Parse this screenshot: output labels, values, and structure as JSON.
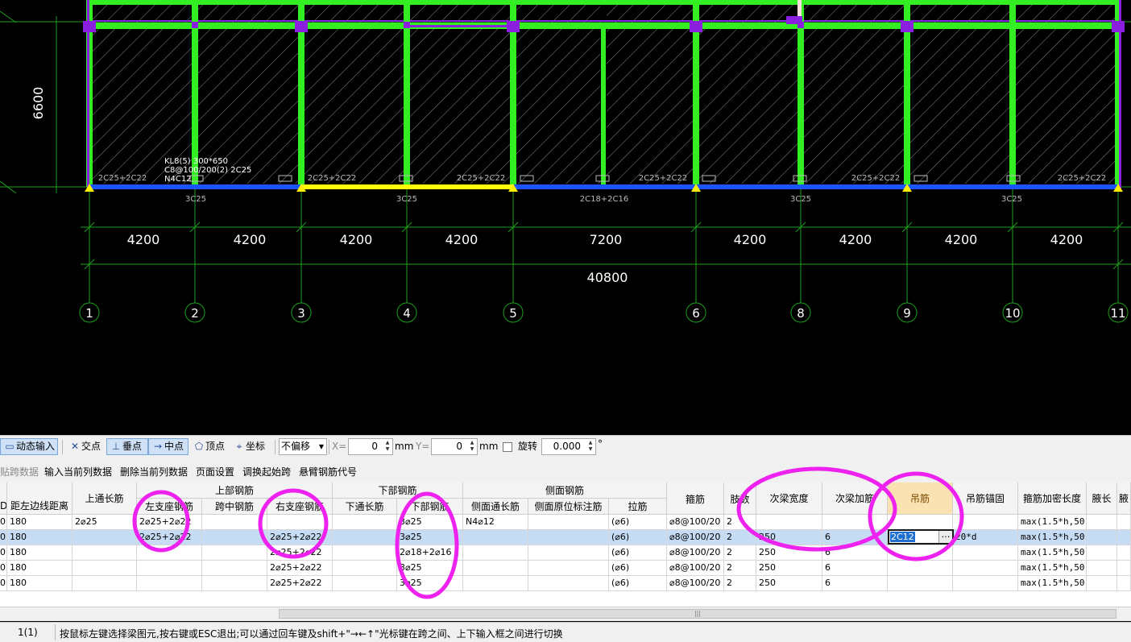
{
  "cad": {
    "span_dims": [
      "4200",
      "4200",
      "4200",
      "4200",
      "7200",
      "4200",
      "4200",
      "4200",
      "4200"
    ],
    "total_dim": "40800",
    "side_dim": "6600",
    "axis_labels": [
      "1",
      "2",
      "3",
      "4",
      "5",
      "6",
      "8",
      "9",
      "10",
      "11"
    ],
    "beam_label_1": "KL8(5) 300*650",
    "beam_label_2": "C8@100/200(2) 2C25",
    "beam_label_3": "N4C12",
    "top_rebar_labels": [
      "2C25+2C22",
      "2C25+2C22",
      "2C25+2C22",
      "2C25+2C22",
      "2C25+2C22",
      "2C25+2C22"
    ],
    "bottom_rebar_labels": [
      "3C25",
      "3C25",
      "2C18+2C16",
      "3C25",
      "3C25"
    ]
  },
  "snapbar": {
    "dynamic_input": "动态输入",
    "intersection": "交点",
    "perpendicular": "垂点",
    "midpoint": "中点",
    "vertex": "顶点",
    "coordinate": "坐标",
    "offset_value": "不偏移",
    "x_label": "X=",
    "x_value": "0",
    "unit1": "mm",
    "y_label": "Y=",
    "y_value": "0",
    "unit2": "mm",
    "rotate_label": "旋转",
    "rotate_value": "0.000",
    "degree": "°"
  },
  "actions": {
    "paste": "贴跨数据",
    "input_current": "输入当前列数据",
    "delete_current": "删除当前列数据",
    "page_setup": "页面设置",
    "swap_start": "调换起始跨",
    "cantilever_code": "悬臂钢筋代号"
  },
  "table": {
    "group_headers": {
      "top": "上部钢筋",
      "bottom": "下部钢筋",
      "side": "侧面钢筋"
    },
    "headers": {
      "c0": "D",
      "dist": "距左边线距离",
      "top_through": "上通长筋",
      "left_support": "左支座钢筋",
      "mid_span": "跨中钢筋",
      "right_support": "右支座钢筋",
      "bottom_through": "下通长筋",
      "bottom_rebar": "下部钢筋",
      "side_through": "侧面通长筋",
      "side_orig": "侧面原位标注筋",
      "tie": "拉筋",
      "stirrup": "箍筋",
      "legs": "肢数",
      "sec_width": "次梁宽度",
      "sec_add": "次梁加筋",
      "hanger": "吊筋",
      "hanger_anchor": "吊筋锚固",
      "dense_len": "箍筋加密长度",
      "haunch": "腋长",
      "haunch2": "腋"
    },
    "rows": [
      {
        "c0": "0",
        "dist": "180",
        "top_through": "2⌀25",
        "left_support": "2⌀25+2⌀22",
        "mid_span": "",
        "right_support": "",
        "bottom_through": "",
        "bottom_rebar": "3⌀25",
        "side_through": "N4⌀12",
        "side_orig": "",
        "tie": "(⌀6)",
        "stirrup": "⌀8@100/20",
        "legs": "2",
        "sec_width": "",
        "sec_add": "",
        "hanger": "",
        "hanger_anchor": "",
        "dense_len": "max(1.5*h,50",
        "haunch": ""
      },
      {
        "c0": "0",
        "dist": "180",
        "top_through": "",
        "left_support": "2⌀25+2⌀22",
        "mid_span": "",
        "right_support": "2⌀25+2⌀22",
        "bottom_through": "",
        "bottom_rebar": "3⌀25",
        "side_through": "",
        "side_orig": "",
        "tie": "(⌀6)",
        "stirrup": "⌀8@100/20",
        "legs": "2",
        "sec_width": "250",
        "sec_add": "6",
        "hanger": "2C12",
        "hanger_anchor": "20*d",
        "dense_len": "max(1.5*h,50",
        "haunch": ""
      },
      {
        "c0": "0",
        "dist": "180",
        "top_through": "",
        "left_support": "",
        "mid_span": "",
        "right_support": "2⌀25+2⌀22",
        "bottom_through": "",
        "bottom_rebar": "2⌀18+2⌀16",
        "side_through": "",
        "side_orig": "",
        "tie": "(⌀6)",
        "stirrup": "⌀8@100/20",
        "legs": "2",
        "sec_width": "250",
        "sec_add": "6",
        "hanger": "",
        "hanger_anchor": "",
        "dense_len": "max(1.5*h,50",
        "haunch": ""
      },
      {
        "c0": "0",
        "dist": "180",
        "top_through": "",
        "left_support": "",
        "mid_span": "",
        "right_support": "2⌀25+2⌀22",
        "bottom_through": "",
        "bottom_rebar": "3⌀25",
        "side_through": "",
        "side_orig": "",
        "tie": "(⌀6)",
        "stirrup": "⌀8@100/20",
        "legs": "2",
        "sec_width": "250",
        "sec_add": "6",
        "hanger": "",
        "hanger_anchor": "",
        "dense_len": "max(1.5*h,50",
        "haunch": ""
      },
      {
        "c0": "0",
        "dist": "180",
        "top_through": "",
        "left_support": "",
        "mid_span": "",
        "right_support": "2⌀25+2⌀22",
        "bottom_through": "",
        "bottom_rebar": "3⌀25",
        "side_through": "",
        "side_orig": "",
        "tie": "(⌀6)",
        "stirrup": "⌀8@100/20",
        "legs": "2",
        "sec_width": "250",
        "sec_add": "6",
        "hanger": "",
        "hanger_anchor": "",
        "dense_len": "max(1.5*h,50",
        "haunch": ""
      }
    ]
  },
  "status": {
    "cell1": "1(1)",
    "message": "按鼠标左键选择梁图元,按右键或ESC退出;可以通过回车键及shift+\"→←↑\"光标键在跨之间、上下输入框之间进行切换"
  },
  "colors": {
    "beam_green": "#33ee22",
    "column_purple": "#8a1fe0",
    "axis_blue": "#1a55ff",
    "selected_yellow": "#ffff00",
    "annotation_magenta": "#ee22ee"
  }
}
